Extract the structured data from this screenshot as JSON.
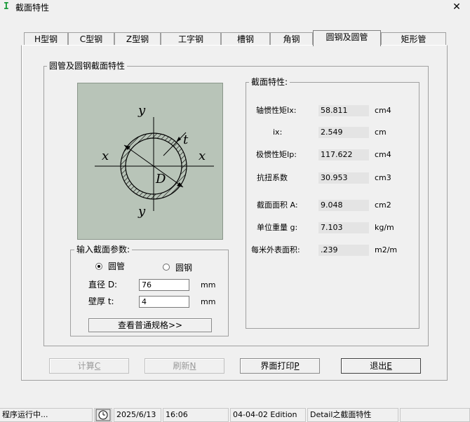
{
  "window": {
    "title": "截面特性",
    "close_glyph": "✕",
    "app_icon": "I"
  },
  "tabs": [
    {
      "label": "H型钢",
      "active": false
    },
    {
      "label": "C型钢",
      "active": false
    },
    {
      "label": "Z型钢",
      "active": false
    },
    {
      "label": "工字钢",
      "active": false
    },
    {
      "label": "槽钢",
      "active": false
    },
    {
      "label": "角钢",
      "active": false
    },
    {
      "label": "圆钢及圆管",
      "active": true
    },
    {
      "label": "矩形管",
      "active": false
    }
  ],
  "outer_group": {
    "title": "圆管及圆钢截面特性"
  },
  "diagram": {
    "y_top": "y",
    "y_bottom": "y",
    "x_left": "x",
    "x_right": "x",
    "t": "t",
    "D": "D"
  },
  "input_group": {
    "title": "输入截面参数:",
    "radio_pipe": "圆管",
    "radio_bar": "圆钢",
    "selected": "圆管",
    "diameter_label": "直径 D:",
    "diameter_value": "76",
    "diameter_unit": "mm",
    "thickness_label": "壁厚 t:",
    "thickness_value": "4",
    "thickness_unit": "mm",
    "view_button": "查看普通规格>>"
  },
  "props_group": {
    "title": "截面特性:",
    "rows": [
      {
        "label": "轴惯性矩Ix:",
        "value": "58.811",
        "unit": "cm4"
      },
      {
        "label": "ix:",
        "value": "2.549",
        "unit": "cm"
      },
      {
        "label": "极惯性矩Ip:",
        "value": "117.622",
        "unit": "cm4"
      },
      {
        "label": "抗扭系数",
        "value": "30.953",
        "unit": "cm3"
      },
      {
        "label": "截面面积 A:",
        "value": "9.048",
        "unit": "cm2"
      },
      {
        "label": "单位重量 g:",
        "value": "7.103",
        "unit": "kg/m"
      },
      {
        "label": "每米外表面积:",
        "value": ".239",
        "unit": "m2/m"
      }
    ]
  },
  "buttons": {
    "calc": {
      "text": "计算",
      "key": "C"
    },
    "refresh": {
      "text": "刷新",
      "key": "N"
    },
    "print": {
      "text": "界面打印",
      "key": "P"
    },
    "exit": {
      "text": "退出",
      "key": "E"
    }
  },
  "status": {
    "state": "程序运行中...",
    "date": "2025/6/13",
    "time": "16:06",
    "edition": "04-04-02 Edition",
    "detail": "Detail之截面特性"
  }
}
